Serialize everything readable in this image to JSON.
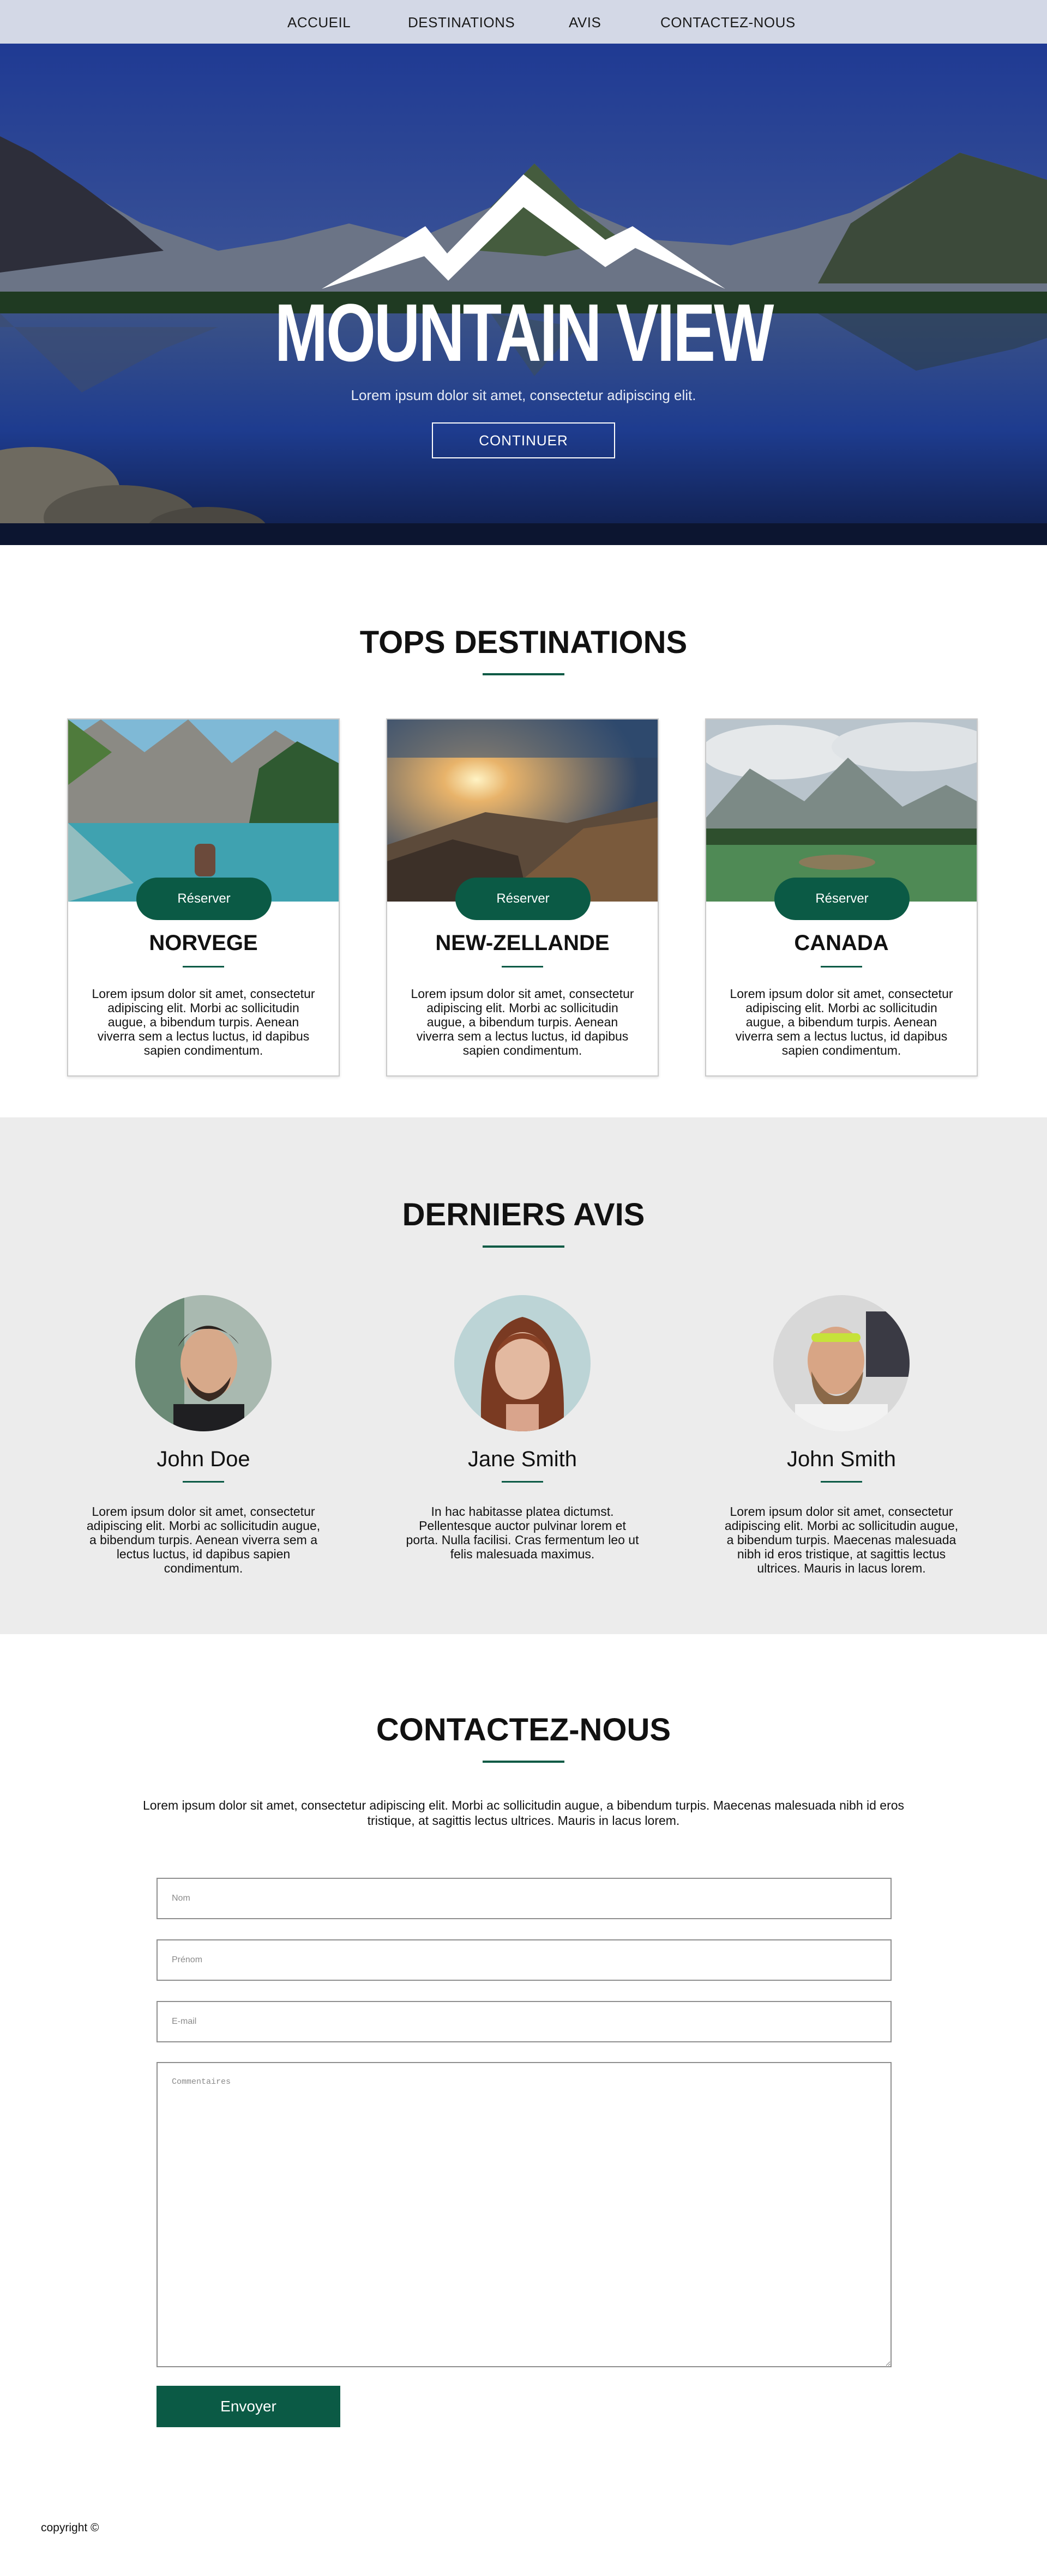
{
  "nav": {
    "items": [
      {
        "label": "ACCUEIL"
      },
      {
        "label": "DESTINATIONS"
      },
      {
        "label": "AVIS"
      },
      {
        "label": "CONTACTEZ-NOUS"
      }
    ]
  },
  "hero": {
    "title": "MOUNTAIN VIEW",
    "subtitle": "Lorem ipsum dolor sit amet, consectetur adipiscing elit.",
    "cta_label": "CONTINUER"
  },
  "destinations": {
    "title": "TOPS DESTINATIONS",
    "cards": [
      {
        "name": "NORVEGE",
        "button": "Réserver",
        "text": "Lorem ipsum dolor sit amet, consectetur adipiscing elit. Morbi ac sollicitudin augue, a bibendum turpis. Aenean viverra sem a lectus luctus, id dapibus sapien condimentum."
      },
      {
        "name": "NEW-ZELLANDE",
        "button": "Réserver",
        "text": "Lorem ipsum dolor sit amet, consectetur adipiscing elit. Morbi ac sollicitudin augue, a bibendum turpis. Aenean viverra sem a lectus luctus, id dapibus sapien condimentum."
      },
      {
        "name": "CANADA",
        "button": "Réserver",
        "text": "Lorem ipsum dolor sit amet, consectetur adipiscing elit. Morbi ac sollicitudin augue, a bibendum turpis. Aenean viverra sem a lectus luctus, id dapibus sapien condimentum."
      }
    ]
  },
  "reviews": {
    "title": "DERNIERS AVIS",
    "items": [
      {
        "name": "John Doe",
        "text": "Lorem ipsum dolor sit amet, consectetur adipiscing elit. Morbi ac sollicitudin augue, a bibendum turpis. Aenean viverra sem a lectus luctus, id dapibus sapien condimentum."
      },
      {
        "name": "Jane Smith",
        "text": "In hac habitasse platea dictumst. Pellentesque auctor pulvinar lorem et porta. Nulla facilisi. Cras fermentum leo ut felis malesuada maximus."
      },
      {
        "name": "John Smith",
        "text": "Lorem ipsum dolor sit amet, consectetur adipiscing elit. Morbi ac sollicitudin augue, a bibendum turpis. Maecenas malesuada nibh id eros tristique, at sagittis lectus ultrices. Mauris in lacus lorem."
      }
    ]
  },
  "contact": {
    "title": "CONTACTEZ-NOUS",
    "intro": "Lorem ipsum dolor sit amet, consectetur adipiscing elit. Morbi ac sollicitudin augue, a bibendum turpis. Maecenas malesuada nibh id eros tristique, at sagittis lectus ultrices. Mauris in lacus lorem.",
    "fields": {
      "name_placeholder": "Nom",
      "firstname_placeholder": "Prénom",
      "email_placeholder": "E-mail",
      "comments_placeholder": "Commentaires"
    },
    "submit_label": "Envoyer"
  },
  "footer": {
    "copyright": "copyright ©"
  },
  "colors": {
    "accent": "#0b5a45",
    "nav_bg": "#d3d8e6",
    "reviews_bg": "#ececec"
  }
}
